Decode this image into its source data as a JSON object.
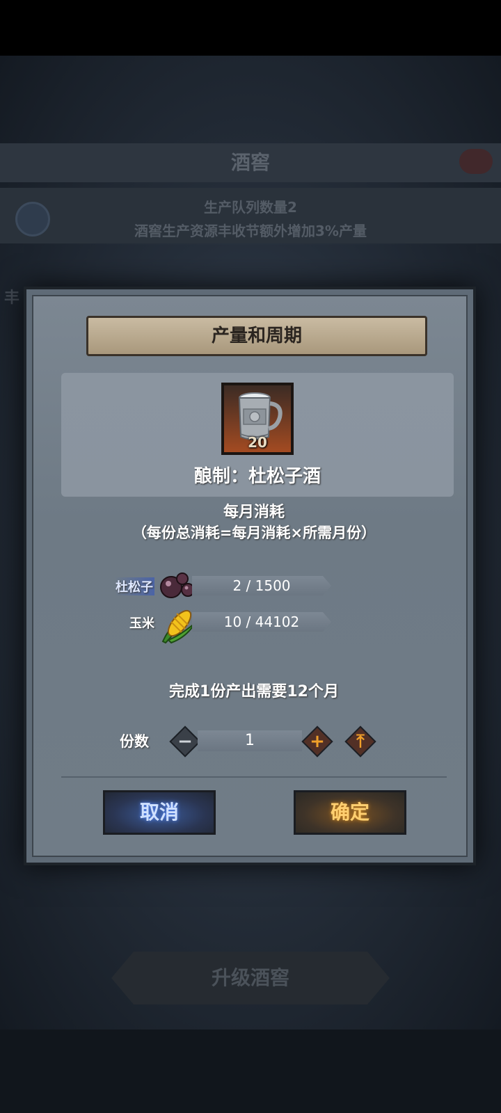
{
  "background": {
    "title": "酒窖",
    "info_line1": "生产队列数量2",
    "info_line2": "酒窖生产资源丰收节额外增加3%产量",
    "left_glyph": "丰",
    "upgrade_label": "升级酒窖"
  },
  "dialog": {
    "title": "产量和周期",
    "item": {
      "icon": "pewter-tankard-icon",
      "count": "20",
      "name": "酿制：杜松子酒"
    },
    "consume_title": "每月消耗",
    "consume_note": "（每份总消耗=每月消耗×所需月份）",
    "resources": [
      {
        "name": "杜松子",
        "icon": "juniper-berry-icon",
        "amount": "2 / 1500"
      },
      {
        "name": "玉米",
        "icon": "corn-icon",
        "amount": "10 / 44102"
      }
    ],
    "time_text": "完成1份产出需要12个月",
    "quantity": {
      "label": "份数",
      "value": "1",
      "decrease": "−",
      "increase": "+",
      "max": "⤒"
    },
    "cancel_label": "取消",
    "confirm_label": "确定"
  },
  "colors": {
    "cancel_glow": "#5a8cff",
    "confirm_glow": "#f0a02a"
  }
}
